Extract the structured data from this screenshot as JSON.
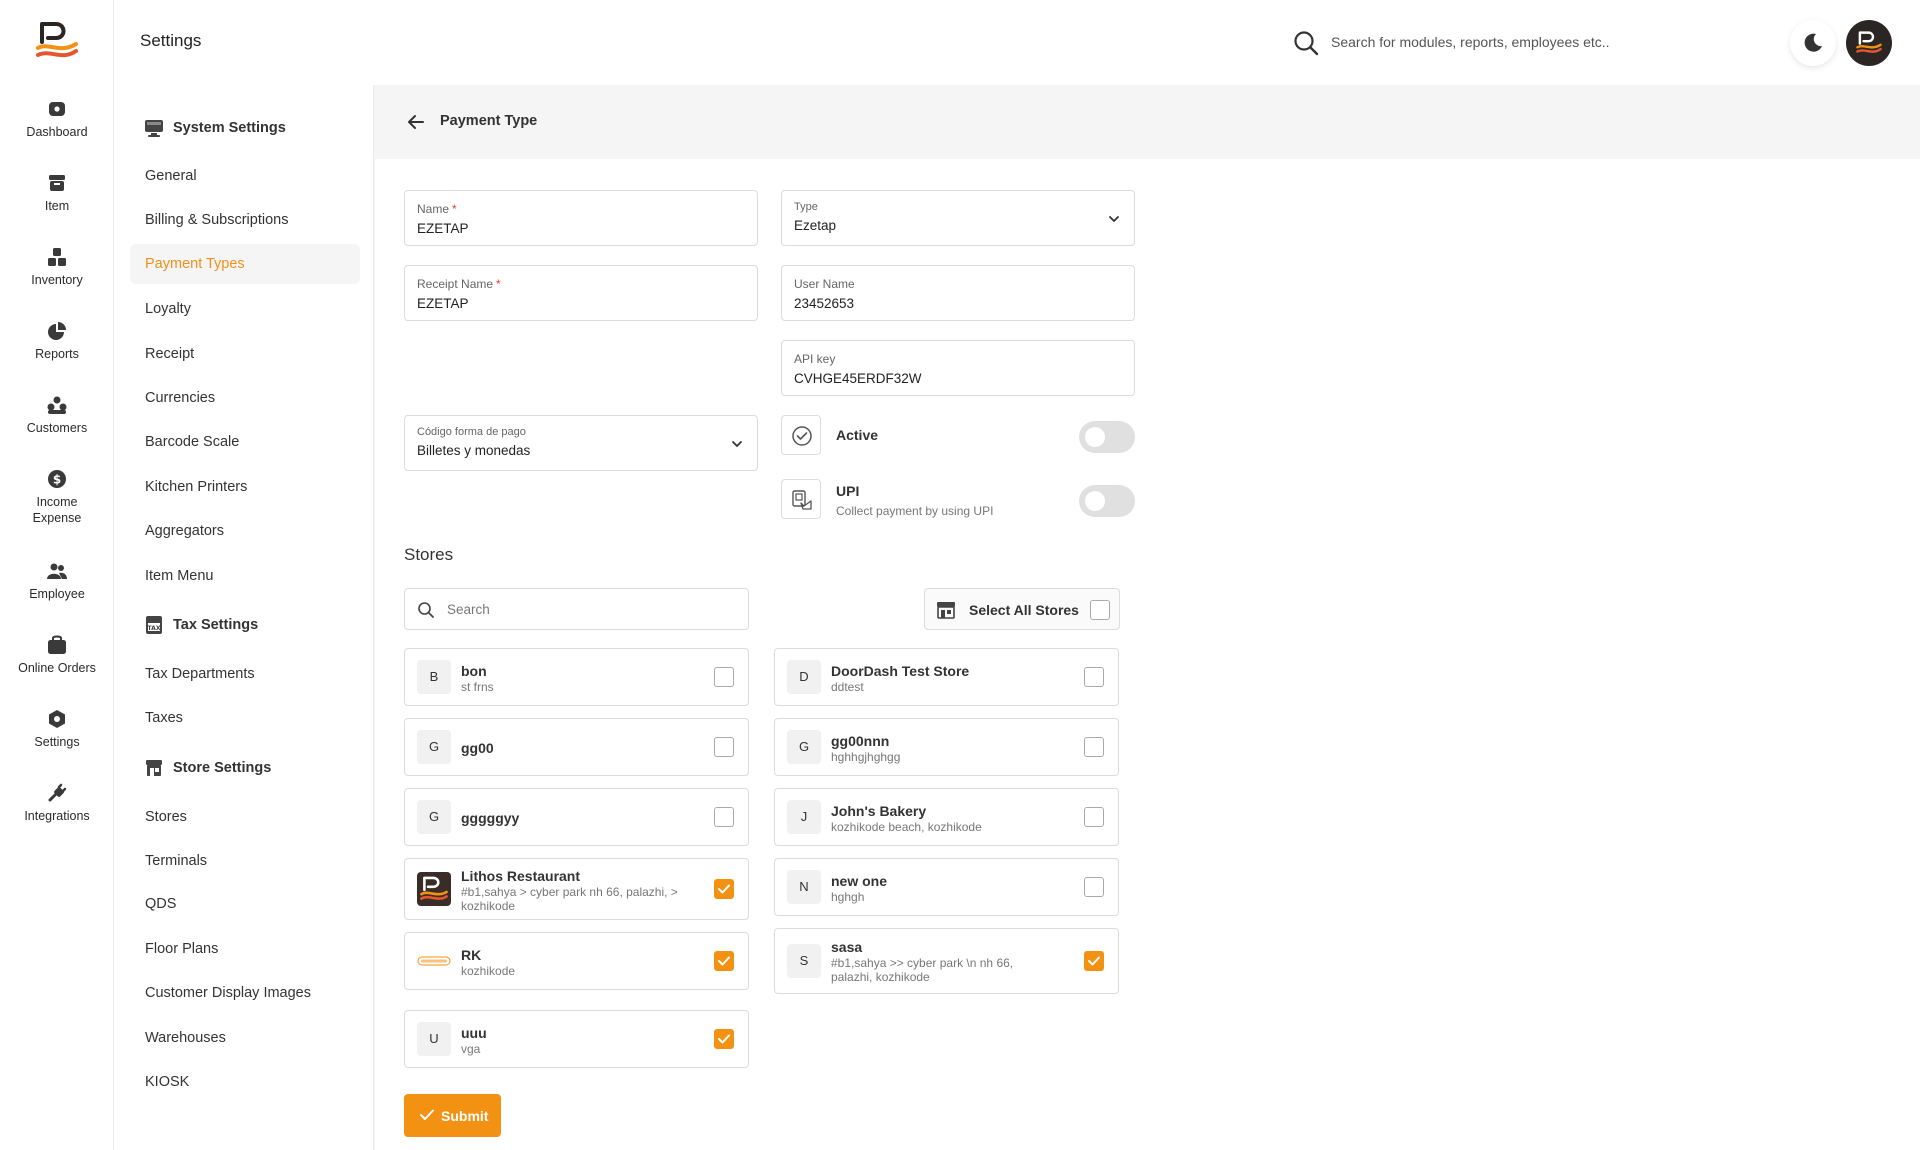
{
  "app": {
    "title": "Settings",
    "search_placeholder": "Search for modules, reports, employees etc.."
  },
  "colors": {
    "accent": "#f39212",
    "active_text": "#f0901b",
    "logo_dark": "#2b2523"
  },
  "rail": [
    {
      "label": "Dashboard",
      "icon": "dashboard-icon"
    },
    {
      "label": "Item",
      "icon": "item-icon"
    },
    {
      "label": "Inventory",
      "icon": "inventory-icon"
    },
    {
      "label": "Reports",
      "icon": "reports-icon"
    },
    {
      "label": "Customers",
      "icon": "customers-icon"
    },
    {
      "label": "Income Expense",
      "icon": "income-expense-icon"
    },
    {
      "label": "Employee",
      "icon": "employee-icon"
    },
    {
      "label": "Online Orders",
      "icon": "online-orders-icon"
    },
    {
      "label": "Settings",
      "icon": "settings-icon"
    },
    {
      "label": "Integrations",
      "icon": "integrations-icon"
    }
  ],
  "menu": {
    "system_settings": "System Settings",
    "system_items": [
      "General",
      "Billing & Subscriptions",
      "Payment Types",
      "Loyalty",
      "Receipt",
      "Currencies",
      "Barcode Scale",
      "Kitchen Printers",
      "Aggregators",
      "Item Menu"
    ],
    "tax_settings": "Tax Settings",
    "tax_items": [
      "Tax Departments",
      "Taxes"
    ],
    "store_settings": "Store Settings",
    "store_items": [
      "Stores",
      "Terminals",
      "QDS",
      "Floor Plans",
      "Customer Display Images",
      "Warehouses",
      "KIOSK"
    ],
    "active": "Payment Types"
  },
  "page": {
    "title": "Payment Type"
  },
  "form": {
    "name": {
      "label": "Name",
      "value": "EZETAP"
    },
    "type": {
      "label": "Type",
      "value": "Ezetap"
    },
    "receipt_name": {
      "label": "Receipt Name",
      "value": "EZETAP"
    },
    "user_name": {
      "label": "User Name",
      "value": "23452653"
    },
    "api_key": {
      "label": "API key",
      "value": "CVHGE45ERDF32W"
    },
    "codigo": {
      "label": "Código forma de pago",
      "value": "Billetes y monedas"
    },
    "active": {
      "label": "Active",
      "enabled": false
    },
    "upi": {
      "label": "UPI",
      "sub": "Collect payment by using UPI",
      "enabled": false
    }
  },
  "stores": {
    "title": "Stores",
    "search_placeholder": "Search",
    "select_all": "Select All Stores",
    "left": [
      {
        "badge": "B",
        "name": "bon",
        "sub": "st frns",
        "checked": false
      },
      {
        "badge": "G",
        "name": "gg00",
        "sub": "",
        "checked": false
      },
      {
        "badge": "G",
        "name": "gggggyy",
        "sub": "",
        "checked": false
      },
      {
        "badge": "",
        "name": "Lithos Restaurant",
        "sub": "#b1,sahya > cyber park nh 66, palazhi, > kozhikode",
        "checked": true
      },
      {
        "badge": "",
        "name": "RK",
        "sub": "kozhikode",
        "checked": true
      },
      {
        "badge": "U",
        "name": "uuu",
        "sub": "vga",
        "checked": true
      }
    ],
    "right": [
      {
        "badge": "D",
        "name": "DoorDash Test Store",
        "sub": "ddtest",
        "checked": false
      },
      {
        "badge": "G",
        "name": "gg00nnn",
        "sub": "hghhgjhghgg",
        "checked": false
      },
      {
        "badge": "J",
        "name": "John's Bakery",
        "sub": "kozhikode beach, kozhikode",
        "checked": false
      },
      {
        "badge": "N",
        "name": "new one",
        "sub": "hghgh",
        "checked": false
      },
      {
        "badge": "S",
        "name": "sasa",
        "sub": "#b1,sahya >> cyber park \\n nh 66, palazhi, kozhikode",
        "checked": true
      }
    ]
  },
  "submit_label": "Submit"
}
